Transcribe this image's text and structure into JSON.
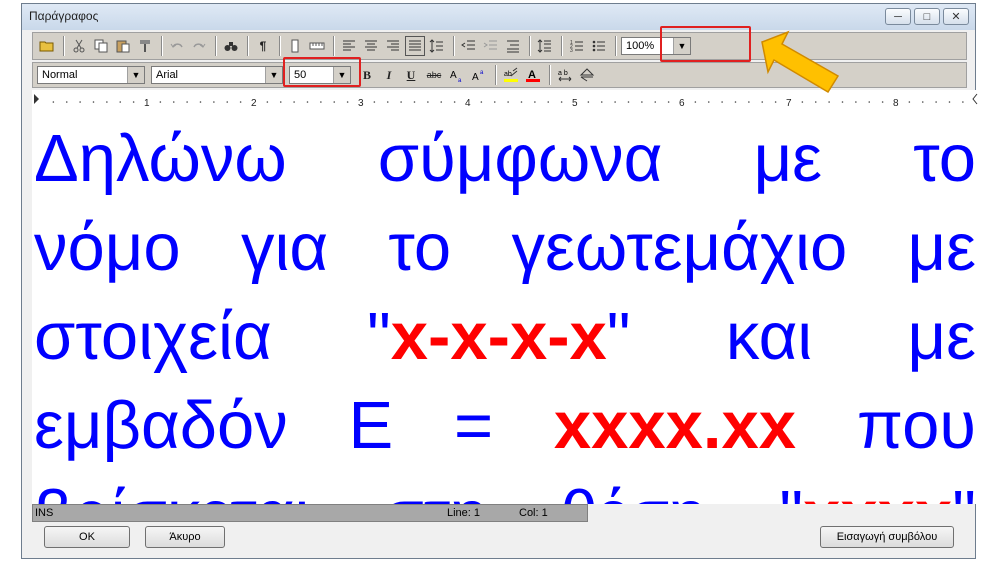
{
  "window": {
    "title": "Παράγραφος"
  },
  "toolbar": {
    "zoom": {
      "value": "100%"
    },
    "style": {
      "value": "Normal"
    },
    "font": {
      "value": "Arial"
    },
    "size": {
      "value": "50"
    },
    "format_buttons": {
      "bold": "B",
      "italic": "I",
      "underline": "U",
      "strike": "abc"
    }
  },
  "ruler": {
    "labels": [
      "1",
      "2",
      "3",
      "4",
      "5",
      "6",
      "7",
      "8"
    ]
  },
  "document": {
    "lines": [
      {
        "parts": [
          {
            "text": "Δηλώνω σύμφωνα με το",
            "emph": false
          }
        ]
      },
      {
        "parts": [
          {
            "text": "νόμο για το γεωτεμάχιο με",
            "emph": false
          }
        ]
      },
      {
        "parts": [
          {
            "text": "στοιχεία \"",
            "emph": false
          },
          {
            "text": "x-x-x-x",
            "emph": true
          },
          {
            "text": "\" και με",
            "emph": false
          }
        ]
      },
      {
        "parts": [
          {
            "text": "εμβαδόν Ε = ",
            "emph": false
          },
          {
            "text": "xxxx.xx",
            "emph": true
          },
          {
            "text": " που",
            "emph": false
          }
        ]
      },
      {
        "parts": [
          {
            "text": "βρίσκεται στη θέση \"",
            "emph": false
          },
          {
            "text": "xxxx",
            "emph": true
          },
          {
            "text": "\"",
            "emph": false
          }
        ]
      }
    ],
    "colors": {
      "text": "#0000ff",
      "emphasis": "#ff0000"
    }
  },
  "status": {
    "mode": "INS",
    "line": "Line: 1",
    "col": "Col: 1"
  },
  "buttons": {
    "ok": "OK",
    "cancel": "Άκυρο",
    "insert_symbol": "Εισαγωγή συμβόλου"
  },
  "annotation": {
    "highlight_color": "#e02020",
    "arrow_color": "#ffc000"
  }
}
